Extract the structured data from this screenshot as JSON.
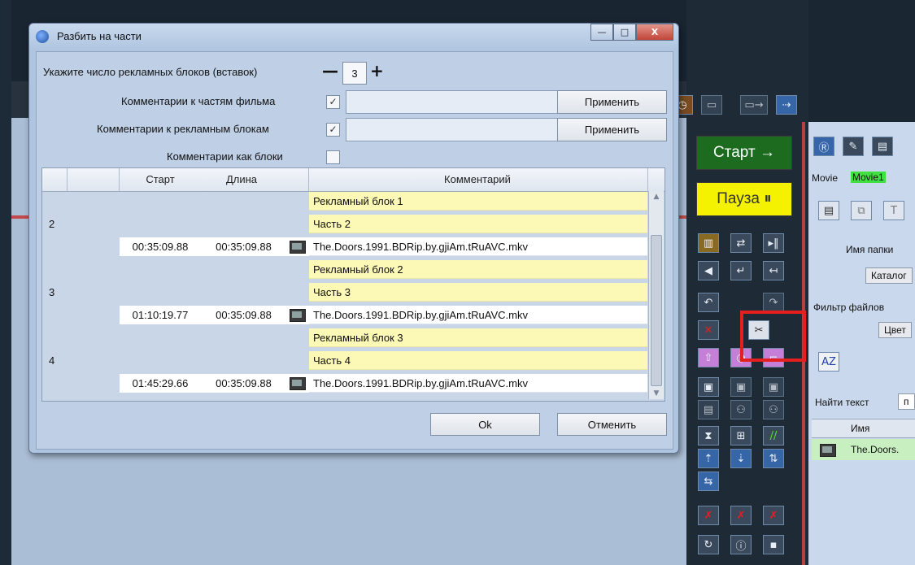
{
  "dialog": {
    "title": "Разбить на части",
    "window_buttons": {
      "minimize": "—",
      "maximize": "□",
      "close": "X"
    },
    "blocks_label": "Укажите число рекламных блоков (вставок)",
    "minus": "—",
    "plus": "+",
    "blocks_count": "3",
    "part_comments_label": "Комментарии к частям фильма",
    "part_comments_checked": "✓",
    "ad_comments_label": "Комментарии к рекламным блокам",
    "ad_comments_checked": "✓",
    "comments_as_blocks_label": "Комментарии как блоки",
    "apply_label": "Применить",
    "ok_label": "Ok",
    "cancel_label": "Отменить"
  },
  "grid": {
    "headers": {
      "start": "Старт",
      "length": "Длина",
      "comment": "Комментарий"
    },
    "groups": [
      {
        "num": "2",
        "ad": "Рекламный блок 1",
        "part": "Часть 2",
        "start": "00:35:09.88",
        "length": "00:35:09.88",
        "file": "The.Doors.1991.BDRip.by.gjiAm.tRuAVC.mkv"
      },
      {
        "num": "3",
        "ad": "Рекламный блок 2",
        "part": "Часть 3",
        "start": "01:10:19.77",
        "length": "00:35:09.88",
        "file": "The.Doors.1991.BDRip.by.gjiAm.tRuAVC.mkv"
      },
      {
        "num": "4",
        "ad": "Рекламный блок 3",
        "part": "Часть 4",
        "start": "01:45:29.66",
        "length": "00:35:09.88",
        "file": "The.Doors.1991.BDRip.by.gjiAm.tRuAVC.mkv"
      }
    ]
  },
  "controls": {
    "start_label": "Старт →",
    "pause_label": "Пауза ⏸"
  },
  "right_panel": {
    "tab_movie": "Movie",
    "tab_movie1": "Movie1",
    "folder_name_label": "Имя папки",
    "catalog_button": "Каталог",
    "file_filter_label": "Фильтр файлов",
    "color_button": "Цвет",
    "find_text_label": "Найти текст",
    "find_text_value": "п",
    "name_column": "Имя",
    "file_row": "The.Doors."
  }
}
